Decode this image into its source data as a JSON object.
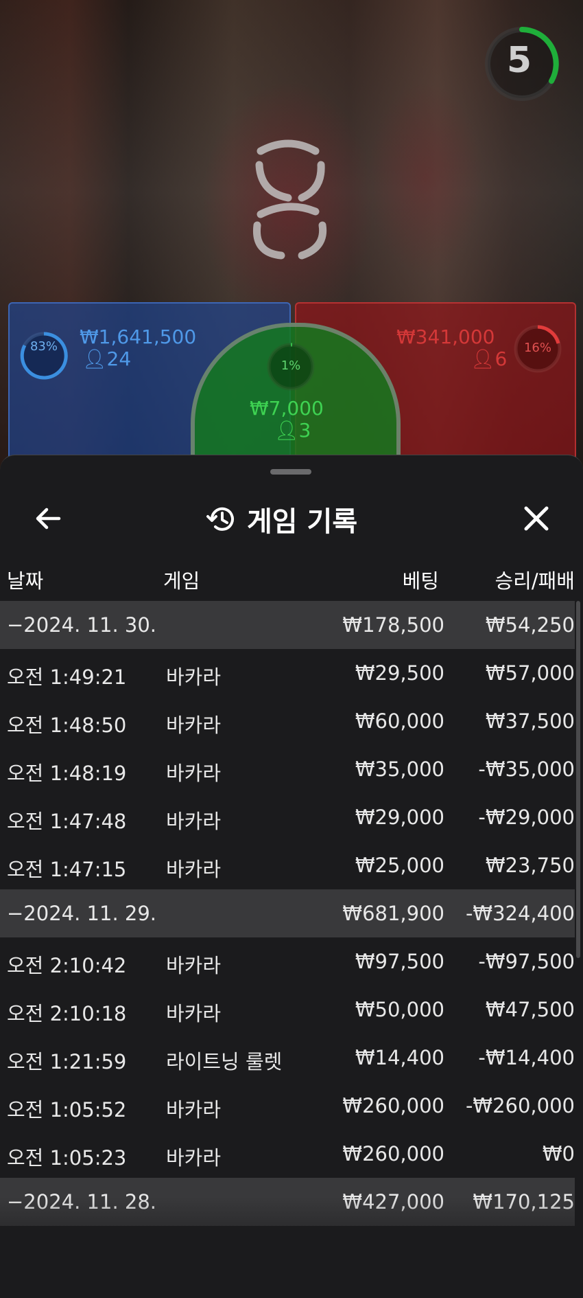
{
  "game_view": {
    "timer": "5",
    "player": {
      "percent": "83%",
      "amount": "₩1,641,500",
      "count": "24"
    },
    "tie": {
      "percent": "1%",
      "amount": "₩7,000",
      "count": "3"
    },
    "banker": {
      "percent": "16%",
      "amount": "₩341,000",
      "count": "6"
    }
  },
  "header": {
    "title": "게임 기록"
  },
  "columns": {
    "date": "날짜",
    "game": "게임",
    "bet": "베팅",
    "result": "승리/패배"
  },
  "rows": [
    {
      "type": "group",
      "date": "−2024. 11. 30.",
      "bet": "₩178,500",
      "result": "₩54,250"
    },
    {
      "type": "item",
      "time": "오전 1:49:21",
      "game": "바카라",
      "bet": "₩29,500",
      "result": "₩57,000"
    },
    {
      "type": "item",
      "time": "오전 1:48:50",
      "game": "바카라",
      "bet": "₩60,000",
      "result": "₩37,500"
    },
    {
      "type": "item",
      "time": "오전 1:48:19",
      "game": "바카라",
      "bet": "₩35,000",
      "result": "-₩35,000"
    },
    {
      "type": "item",
      "time": "오전 1:47:48",
      "game": "바카라",
      "bet": "₩29,000",
      "result": "-₩29,000"
    },
    {
      "type": "item",
      "time": "오전 1:47:15",
      "game": "바카라",
      "bet": "₩25,000",
      "result": "₩23,750"
    },
    {
      "type": "group",
      "date": "−2024. 11. 29.",
      "bet": "₩681,900",
      "result": "-₩324,400"
    },
    {
      "type": "item",
      "time": "오전 2:10:42",
      "game": "바카라",
      "bet": "₩97,500",
      "result": "-₩97,500"
    },
    {
      "type": "item",
      "time": "오전 2:10:18",
      "game": "바카라",
      "bet": "₩50,000",
      "result": "₩47,500"
    },
    {
      "type": "item",
      "time": "오전 1:21:59",
      "game": "라이트닝 룰렛",
      "bet": "₩14,400",
      "result": "-₩14,400"
    },
    {
      "type": "item",
      "time": "오전 1:05:52",
      "game": "바카라",
      "bet": "₩260,000",
      "result": "-₩260,000"
    },
    {
      "type": "item",
      "time": "오전 1:05:23",
      "game": "바카라",
      "bet": "₩260,000",
      "result": "₩0"
    },
    {
      "type": "group",
      "date": "−2024. 11. 28.",
      "bet": "₩427,000",
      "result": "₩170,125"
    }
  ]
}
